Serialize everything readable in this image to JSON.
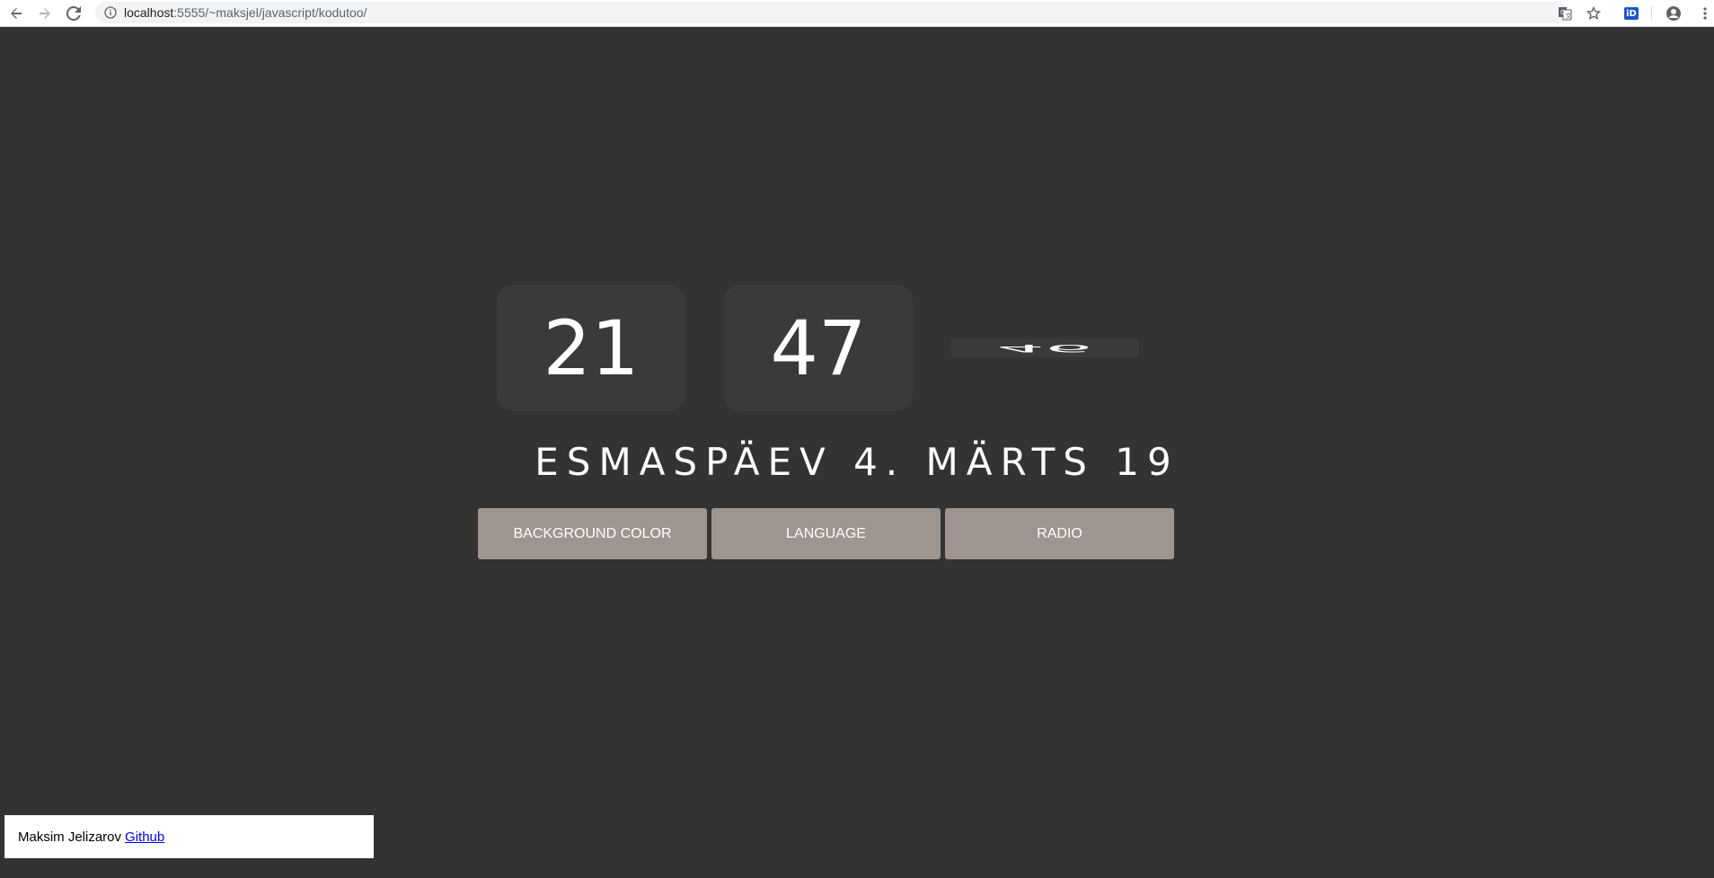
{
  "browser": {
    "url_host": "localhost",
    "url_path": ":5555/~maksjel/javascript/kodutoo/",
    "icons": {
      "back": "arrow-left-icon",
      "forward": "arrow-right-icon",
      "reload": "reload-icon",
      "info": "info-icon",
      "translate": "translate-icon",
      "bookmark": "star-icon",
      "extension": "id-card-icon",
      "profile": "account-icon",
      "menu": "kebab-menu-icon"
    },
    "extension_label": "iD"
  },
  "clock": {
    "hours": "21",
    "minutes": "47",
    "seconds": "46",
    "date": "ESMASPÄEV 4. MÄRTS 19"
  },
  "controls": {
    "background_color_label": "BACKGROUND COLOR",
    "language_label": "LANGUAGE",
    "radio_label": "RADIO"
  },
  "footer": {
    "author": "Maksim Jelizarov",
    "link_label": "Github"
  },
  "colors": {
    "page_background": "#333333",
    "box_background": "#3a3a3a",
    "button_background": "#9e9490",
    "text": "#ffffff",
    "link": "#0000ee"
  }
}
